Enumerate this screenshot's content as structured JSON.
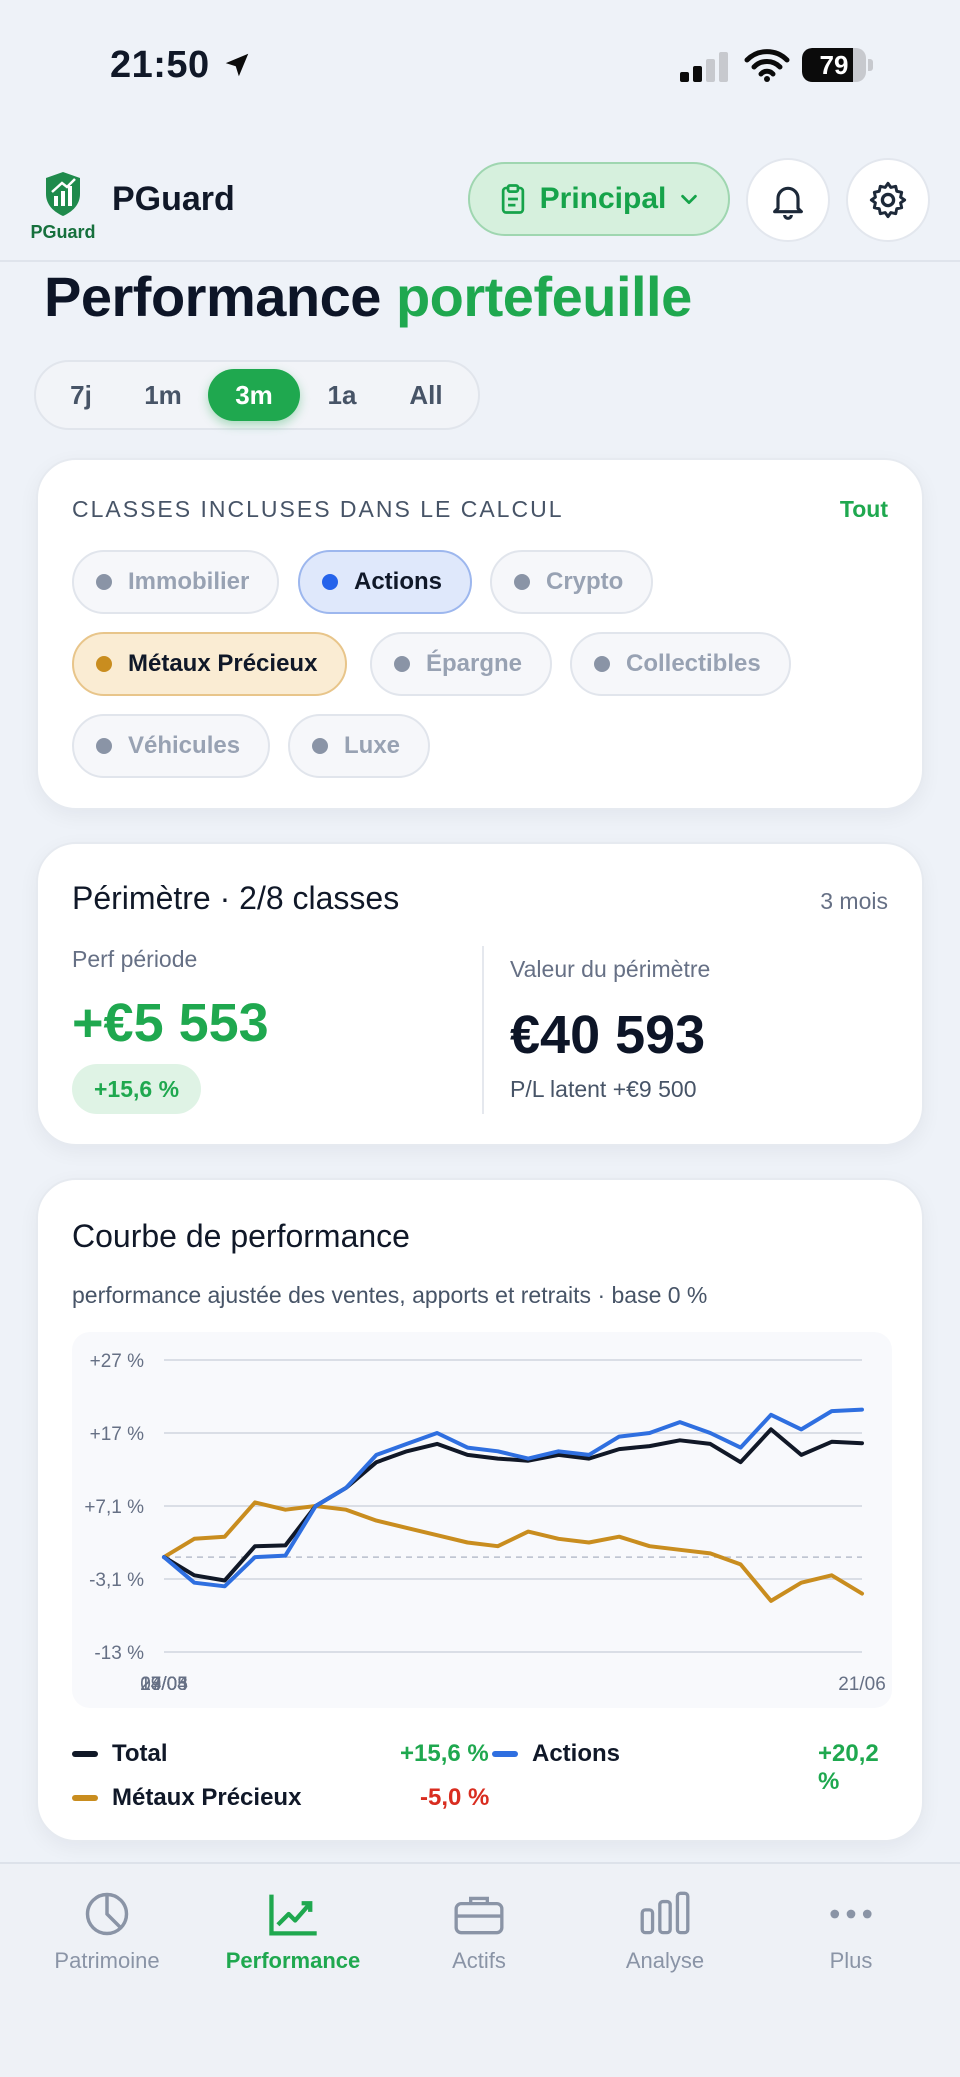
{
  "status": {
    "time": "21:50",
    "battery": "79",
    "battery_level": 0.79
  },
  "header": {
    "logo_text": "PGuard",
    "app_name": "PGuard",
    "portfolio_label": "Principal"
  },
  "page": {
    "title_main": "Performance",
    "title_accent": "portefeuille"
  },
  "range_tabs": [
    {
      "label": "7j",
      "active": false
    },
    {
      "label": "1m",
      "active": false
    },
    {
      "label": "3m",
      "active": true
    },
    {
      "label": "1a",
      "active": false
    },
    {
      "label": "All",
      "active": false
    }
  ],
  "classes": {
    "heading": "CLASSES INCLUSES DANS LE CALCUL",
    "all_link": "Tout",
    "chips": [
      {
        "label": "Immobilier",
        "state": "off"
      },
      {
        "label": "Actions",
        "state": "on-blue"
      },
      {
        "label": "Crypto",
        "state": "off"
      },
      {
        "label": "Métaux Précieux",
        "state": "on-gold"
      },
      {
        "label": "Épargne",
        "state": "off"
      },
      {
        "label": "Collectibles",
        "state": "off"
      },
      {
        "label": "Véhicules",
        "state": "off"
      },
      {
        "label": "Luxe",
        "state": "off"
      }
    ]
  },
  "perimeter": {
    "title": "Périmètre · 2/8 classes",
    "period": "3 mois",
    "perf_label": "Perf période",
    "perf_value": "+€5 553",
    "perf_pct": "+15,6 %",
    "value_label": "Valeur du périmètre",
    "value": "€40 593",
    "pl_latent": "P/L latent +€9 500"
  },
  "chart_card": {
    "title": "Courbe de performance",
    "subtitle": "performance ajustée des ventes, apports et retraits · base 0 %"
  },
  "chart_data": {
    "type": "line",
    "x": [
      "23/03",
      "27/03",
      "31/03",
      "04/04",
      "08/04",
      "12/04",
      "16/04",
      "20/04",
      "24/04",
      "28/04",
      "02/05",
      "06/05",
      "10/05",
      "14/05",
      "18/05",
      "22/05",
      "26/05",
      "30/05",
      "03/06",
      "07/06",
      "11/06",
      "15/06",
      "19/06",
      "21/06"
    ],
    "xticks": [
      "23/03",
      "14/04",
      "07/05",
      "29/05",
      "21/06"
    ],
    "yticks": [
      "+27 %",
      "+17 %",
      "+7,1 %",
      "-3,1 %",
      "-13 %"
    ],
    "ylim": [
      -13,
      27
    ],
    "zero_line": 0,
    "series": [
      {
        "name": "Total",
        "color": "#111827",
        "values": [
          0,
          -2.5,
          -3.2,
          1.5,
          1.6,
          7.0,
          9.5,
          13.0,
          14.5,
          15.5,
          14.0,
          13.5,
          13.2,
          14.0,
          13.5,
          14.8,
          15.2,
          16.0,
          15.5,
          13.0,
          17.5,
          14.0,
          15.8,
          15.6
        ]
      },
      {
        "name": "Actions",
        "color": "#2f6fe0",
        "values": [
          0,
          -3.5,
          -4.0,
          0,
          0.2,
          7.0,
          9.5,
          14.0,
          15.5,
          17.0,
          15.0,
          14.5,
          13.5,
          14.5,
          14.0,
          16.5,
          17.0,
          18.5,
          17.0,
          15.0,
          19.5,
          17.5,
          20.0,
          20.2
        ]
      },
      {
        "name": "Métaux Précieux",
        "color": "#c98d1f",
        "values": [
          0,
          2.5,
          2.8,
          7.5,
          6.5,
          7.0,
          6.5,
          5.0,
          4.0,
          3.0,
          2.0,
          1.5,
          3.5,
          2.5,
          2.0,
          2.8,
          1.5,
          1.0,
          0.5,
          -1.0,
          -6.0,
          -3.5,
          -2.5,
          -5.0
        ]
      }
    ]
  },
  "legend": [
    {
      "name": "Total",
      "value": "+15,6 %",
      "color": "#111827",
      "value_color": "#1fa84f"
    },
    {
      "name": "Actions",
      "value": "+20,2 %",
      "color": "#2f6fe0",
      "value_color": "#1fa84f"
    },
    {
      "name": "Métaux Précieux",
      "value": "-5,0 %",
      "color": "#c98d1f",
      "value_color": "#d92d20"
    }
  ],
  "tabbar": [
    {
      "label": "Patrimoine",
      "icon": "pie-chart-icon",
      "active": false
    },
    {
      "label": "Performance",
      "icon": "trend-up-icon",
      "active": true
    },
    {
      "label": "Actifs",
      "icon": "briefcase-icon",
      "active": false
    },
    {
      "label": "Analyse",
      "icon": "bar-chart-icon",
      "active": false
    },
    {
      "label": "Plus",
      "icon": "more-icon",
      "active": false
    }
  ]
}
